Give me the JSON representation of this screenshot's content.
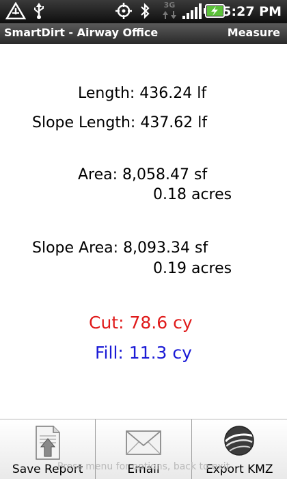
{
  "status_bar": {
    "time": "5:27 PM",
    "network_label": "3G",
    "icons": [
      "signal-alert-icon",
      "usb-icon",
      "gps-icon",
      "bluetooth-icon",
      "data-3g-icon",
      "signal-bars-icon",
      "battery-charging-icon"
    ]
  },
  "title_bar": {
    "app_title": "SmartDirt - Airway Office",
    "page_title": "Measure"
  },
  "measurements": {
    "length": "Length: 436.24 lf",
    "slope_length": "Slope Length: 437.62 lf",
    "area": "Area: 8,058.47 sf",
    "area_acres": "0.18 acres",
    "slope_area": "Slope Area: 8,093.34 sf",
    "slope_area_acres": "0.19 acres",
    "cut": "Cut: 78.6 cy",
    "fill": "Fill: 11.3 cy"
  },
  "colors": {
    "cut": "#e01a1a",
    "fill": "#1a1ad6",
    "battery": "#5cc13a"
  },
  "bottom_bar": {
    "menu_hint": "Press menu for options, back to exit",
    "buttons": [
      {
        "label": "Save Report",
        "icon": "save-report-icon"
      },
      {
        "label": "Email",
        "icon": "envelope-icon"
      },
      {
        "label": "Export KMZ",
        "icon": "google-earth-icon"
      }
    ]
  }
}
